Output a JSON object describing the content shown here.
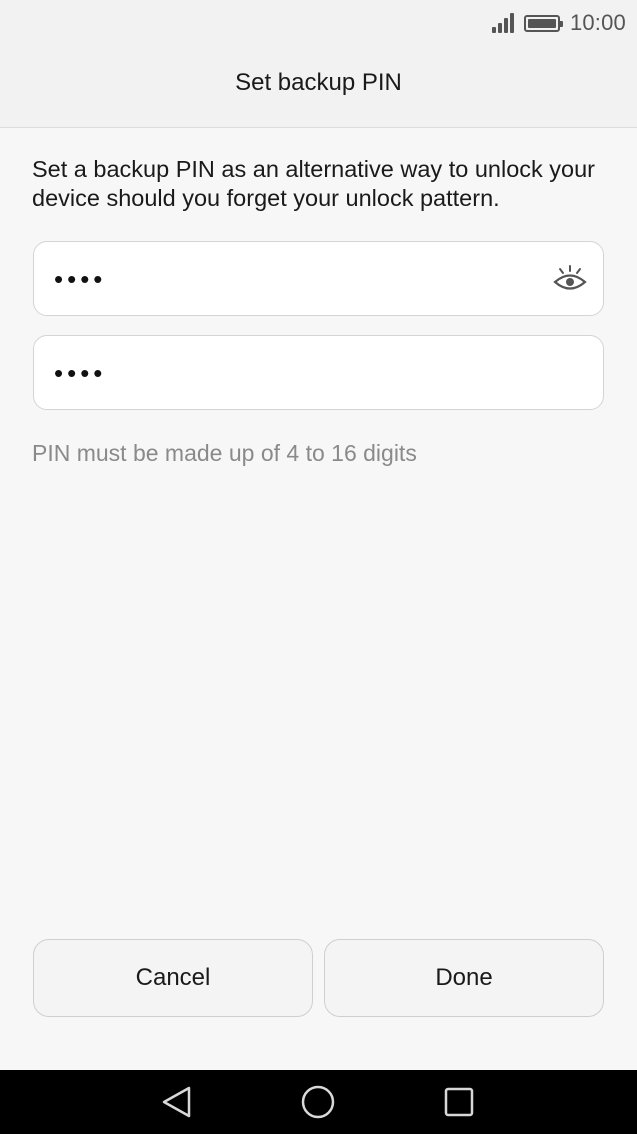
{
  "status_bar": {
    "time": "10:00",
    "signal_icon": "signal-icon",
    "battery_icon": "battery-icon"
  },
  "header": {
    "title": "Set backup PIN"
  },
  "main": {
    "description": "Set a backup PIN as an alternative way to unlock your device should you forget your unlock pattern.",
    "pin_field": {
      "value": "••••",
      "toggle_icon": "eye-icon"
    },
    "confirm_field": {
      "value": "••••"
    },
    "hint": "PIN must be made up of 4 to 16 digits"
  },
  "actions": {
    "cancel_label": "Cancel",
    "done_label": "Done"
  },
  "nav_bar": {
    "back_icon": "back-triangle-icon",
    "home_icon": "home-circle-icon",
    "recents_icon": "recents-square-icon"
  }
}
